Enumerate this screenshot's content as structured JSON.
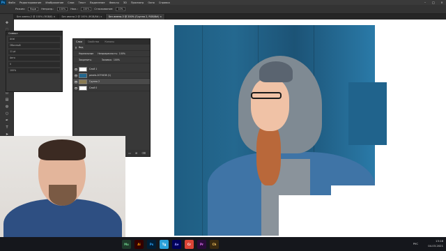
{
  "menubar": {
    "app_icon": "Ps",
    "items": [
      "Файл",
      "Редактирование",
      "Изображение",
      "Слои",
      "Текст",
      "Выделение",
      "Фильтр",
      "3D",
      "Просмотр",
      "Окно",
      "Справка"
    ]
  },
  "options_bar": {
    "mode_label": "Режим:",
    "mode_value": "Норм",
    "opacity_label": "Непрозр.:",
    "opacity_value": "100%",
    "pressure_label": "Наж.:",
    "pressure_value": "100%",
    "smoothing_label": "Сглаживание:",
    "smoothing_value": "10%"
  },
  "document_tabs": [
    {
      "label": "Без имени-2 @ 100% (RGB/8) ×",
      "active": false
    },
    {
      "label": "Без имени-2 @ 100% (RGB/8#) ×",
      "active": false
    },
    {
      "label": "Без имени-3 @ 200% (Группа 2, RGB/8#) ×",
      "active": true
    }
  ],
  "small_panel": {
    "title": "Символ",
    "rows": [
      "Arial",
      "Обычный",
      "11 pt",
      "Авто",
      "0",
      "100%"
    ]
  },
  "layers_panel": {
    "tabs": [
      "Слои",
      "Свойства",
      "Каналы"
    ],
    "filter_label": "Вид",
    "blend_mode": "Нормальные",
    "opacity_label": "Непрозрачность:",
    "opacity_value": "100%",
    "fill_label": "Заливка:",
    "fill_value": "100%",
    "lock_label": "Закрепить:",
    "layers": [
      {
        "name": "Слой 1",
        "visible": true,
        "selected": false
      },
      {
        "name": "pexels-2079438 (1)",
        "visible": true,
        "selected": false
      },
      {
        "name": "Группа 2",
        "visible": true,
        "selected": true
      },
      {
        "name": "Слой 0",
        "visible": true,
        "selected": false
      }
    ]
  },
  "taskbar": {
    "apps": [
      "Mu",
      "Ai",
      "Ps",
      "Tg",
      "Ae",
      "Cr",
      "Pr",
      "Ch"
    ],
    "language": "РУС",
    "time": "13:18",
    "date": "04.03.2021"
  },
  "colors": {
    "ps_blue": "#31a8ff",
    "canvas_blue": "#20638c",
    "panel_bg": "#383838"
  }
}
